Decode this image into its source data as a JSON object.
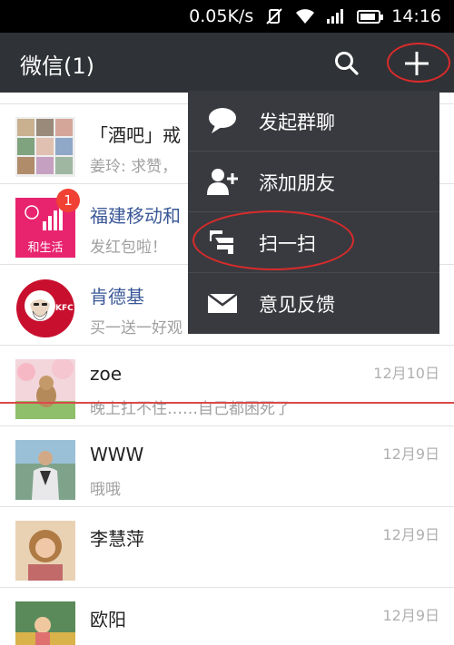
{
  "status_bar": {
    "network_speed": "0.05K/s",
    "time": "14:16"
  },
  "header": {
    "title": "微信(1)"
  },
  "chats": [
    {
      "name": "「酒吧」戒",
      "preview": "姜玲: 求赞，",
      "time": "",
      "badge": ""
    },
    {
      "name": "福建移动和",
      "preview": "发红包啦！",
      "time": "",
      "badge": "1",
      "avatar_label": "和生活"
    },
    {
      "name": "肯德基",
      "preview": "买一送一好观",
      "time": "",
      "badge": "",
      "avatar_label": "KFC"
    },
    {
      "name": "zoe",
      "preview": "晚上扛不住……自己都困死了",
      "time": "12月10日",
      "badge": ""
    },
    {
      "name": "WWW",
      "preview": "哦哦",
      "time": "12月9日",
      "badge": ""
    },
    {
      "name": "李慧萍",
      "preview": "",
      "time": "12月9日",
      "badge": ""
    },
    {
      "name": "欧阳",
      "preview": "",
      "time": "12月9日",
      "badge": ""
    }
  ],
  "menu": {
    "items": [
      {
        "label": "发起群聊",
        "icon": "chat-bubble-icon"
      },
      {
        "label": "添加朋友",
        "icon": "add-user-icon"
      },
      {
        "label": "扫一扫",
        "icon": "scan-icon"
      },
      {
        "label": "意见反馈",
        "icon": "envelope-icon"
      }
    ]
  },
  "colors": {
    "title_bar": "#2f3236",
    "menu_bg": "#393a3f",
    "badge": "#f04134",
    "annotation": "#d92b2b",
    "link_name": "#3b5998"
  }
}
